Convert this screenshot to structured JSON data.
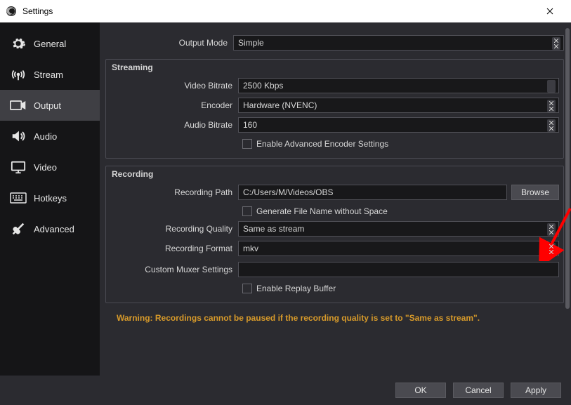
{
  "window": {
    "title": "Settings"
  },
  "sidebar": {
    "items": [
      {
        "label": "General"
      },
      {
        "label": "Stream"
      },
      {
        "label": "Output"
      },
      {
        "label": "Audio"
      },
      {
        "label": "Video"
      },
      {
        "label": "Hotkeys"
      },
      {
        "label": "Advanced"
      }
    ]
  },
  "top": {
    "output_mode_label": "Output Mode",
    "output_mode_value": "Simple"
  },
  "streaming": {
    "title": "Streaming",
    "video_bitrate_label": "Video Bitrate",
    "video_bitrate_value": "2500 Kbps",
    "encoder_label": "Encoder",
    "encoder_value": "Hardware (NVENC)",
    "audio_bitrate_label": "Audio Bitrate",
    "audio_bitrate_value": "160",
    "advanced_encoder_label": "Enable Advanced Encoder Settings"
  },
  "recording": {
    "title": "Recording",
    "path_label": "Recording Path",
    "path_value": "C:/Users/M/Videos/OBS",
    "browse_label": "Browse",
    "gen_filename_label": "Generate File Name without Space",
    "quality_label": "Recording Quality",
    "quality_value": "Same as stream",
    "format_label": "Recording Format",
    "format_value": "mkv",
    "muxer_label": "Custom Muxer Settings",
    "muxer_value": "",
    "replay_buffer_label": "Enable Replay Buffer"
  },
  "warning_text": "Warning: Recordings cannot be paused if the recording quality is set to \"Same as stream\".",
  "footer": {
    "ok_label": "OK",
    "cancel_label": "Cancel",
    "apply_label": "Apply"
  }
}
